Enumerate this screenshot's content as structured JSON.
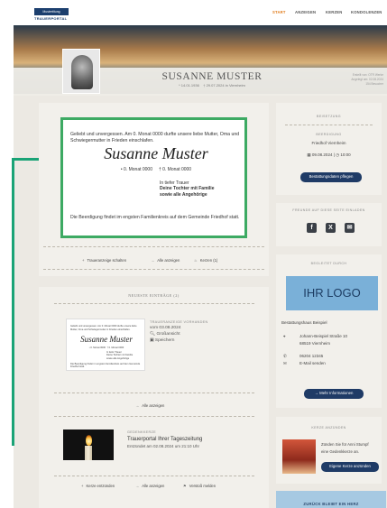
{
  "header": {
    "brand_box": "Mustertitung",
    "brand_text": "TRAUERPORTAL",
    "nav": [
      "START",
      "ANZEIGEN",
      "KERZEN",
      "KONDOLENZEN"
    ]
  },
  "profile": {
    "name": "SUSANNE MUSTER",
    "born": "* 14.01.1936",
    "died": "† 29.07.2024 in Viernheim",
    "meta": [
      "Erstellt von: OTR Werke",
      "Angelegt am: 02.08.2024",
      "154 Besucher"
    ]
  },
  "notice": {
    "intro": "Geliebt und unvergessen. Am 0. Monat 0000 durfte unsere liebe Mutter, Oma und Schwiegermutter in Frieden einschlafen.",
    "name": "Susanne Muster",
    "born": "• 0. Monat 0000",
    "died": "† 0. Monat 0000",
    "mourn_label": "In tiefer Trauer",
    "mourn_line1": "Deine Tochter mit Familie",
    "mourn_line2": "sowie alle Angehörige",
    "outro": "Die Beerdigung findet im engsten Familienkreis auf dem Gemeinde Friedhof statt."
  },
  "main_actions": {
    "create": "Traueranzeige schalten",
    "show_all": "Alle anzeigen",
    "candles": "Kerzen (1)"
  },
  "recent": {
    "title": "NEUESTE EINTRÄGE (2)",
    "entry1_cap": "TRAUERANZEIGE VORHANDEN",
    "entry1_date": "vom 03.08.2024",
    "entry1_zoom": "Großansicht",
    "entry1_save": "Speichern",
    "show_all": "Alle anzeigen",
    "entry2_cap": "GEDENKKERZE",
    "entry2_title": "Trauerportal Ihrer Tageszeitung",
    "entry2_date": "Entzündet am 02.08.2024 um 21:10 Uhr",
    "light_candle": "Kerze entzünden",
    "show_all2": "Alle anzeigen",
    "report": "Verstoß melden"
  },
  "burial": {
    "caption": "BEISETZUNG",
    "sub_caption": "BEERDIGUNG",
    "place": "Friedhof Viernheim",
    "date": "09.08.2024",
    "time": "10:00",
    "button": "Bestattungsdaten pflegen"
  },
  "share": {
    "caption": "FREUNDE AUF DIESE SEITE EINLADEN",
    "icons": [
      "facebook-icon",
      "x-icon",
      "mail-icon"
    ]
  },
  "undertaker": {
    "caption": "BEGLEITET DURCH",
    "logo_text": "IHR LOGO",
    "name": "Bestattungshaus Beispiel",
    "street": "Johann-Beispiel Straße 10",
    "city": "68519 Viernheim",
    "phone": "06204 12345",
    "email": "E-Mail senden",
    "more_button": "Mehr Informationen"
  },
  "candle": {
    "caption": "KERZE ANZÜNDEN",
    "text1": "Zünden Sie für Anni Stumpf",
    "text2": "eine Gedenkkerze an.",
    "button": "Eigene Kerze anzünden"
  },
  "bottom": {
    "text": "ZURÜCK BLEIBT EIN HERZ"
  }
}
